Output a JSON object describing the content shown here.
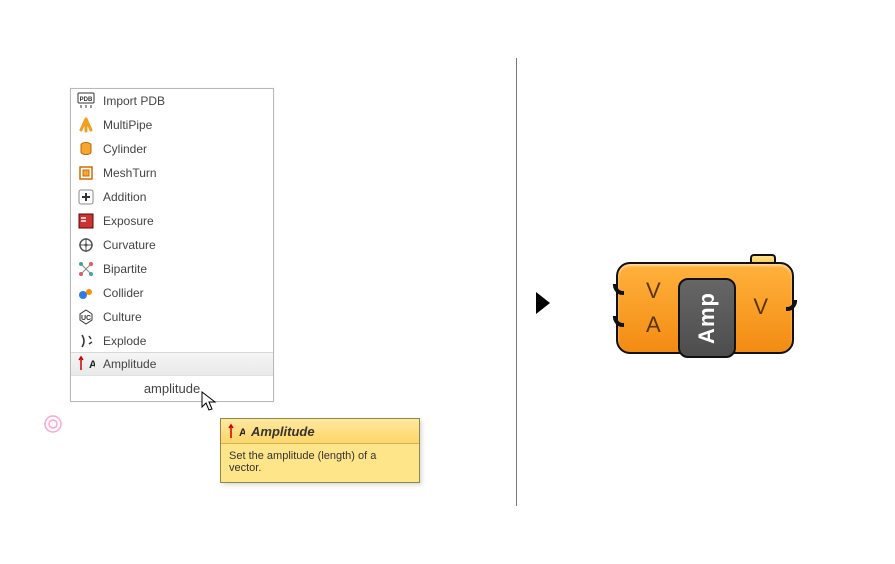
{
  "menu": {
    "items": [
      {
        "label": "Import PDB",
        "iconName": "pdb-icon"
      },
      {
        "label": "MultiPipe",
        "iconName": "pipe-icon"
      },
      {
        "label": "Cylinder",
        "iconName": "cylinder-icon"
      },
      {
        "label": "MeshTurn",
        "iconName": "meshturn-icon"
      },
      {
        "label": "Addition",
        "iconName": "addition-icon"
      },
      {
        "label": "Exposure",
        "iconName": "exposure-icon"
      },
      {
        "label": "Curvature",
        "iconName": "curvature-icon"
      },
      {
        "label": "Bipartite",
        "iconName": "bipartite-icon"
      },
      {
        "label": "Collider",
        "iconName": "collider-icon"
      },
      {
        "label": "Culture",
        "iconName": "culture-icon"
      },
      {
        "label": "Explode",
        "iconName": "explode-icon"
      },
      {
        "label": "Amplitude",
        "iconName": "amplitude-icon"
      }
    ],
    "hoverIndex": 11,
    "search": "amplitude"
  },
  "tooltip": {
    "title": "Amplitude",
    "body": "Set the amplitude (length) of a vector."
  },
  "component": {
    "name": "Amp",
    "inputs": [
      "V",
      "A"
    ],
    "outputs": [
      "V"
    ]
  }
}
